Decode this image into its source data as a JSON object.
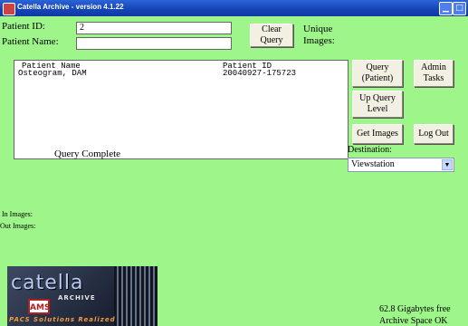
{
  "window": {
    "title": "Catella Archive - version 4.1.22"
  },
  "patient": {
    "id_label": "Patient ID:",
    "id_value": "2",
    "name_label": "Patient Name:",
    "name_value": ""
  },
  "buttons": {
    "clear_query": "Clear Query",
    "query_patient": "Query (Patient)",
    "admin_tasks": "Admin Tasks",
    "up_query_level": "Up Query Level",
    "get_images": "Get Images",
    "log_out": "Log Out"
  },
  "unique_images_label": "Unique Images:",
  "results": {
    "headers": {
      "name": "Patient Name",
      "id": "Patient ID"
    },
    "rows": [
      {
        "name": "Osteogram, DAM",
        "id": "20040927-175723"
      }
    ]
  },
  "status": {
    "query": "Query Complete"
  },
  "destination": {
    "label": "Destination:",
    "selected": "Viewstation"
  },
  "counters": {
    "in_label": "In Images:",
    "out_label": "Out Images:"
  },
  "logo": {
    "word": "catella",
    "sub": "ARCHIVE",
    "badge": "AMS",
    "tagline": "PACS Solutions Realized"
  },
  "disk": {
    "free": "62.8 Gigabytes free",
    "status": "Archive Space OK"
  },
  "icons": {
    "minimize": "minimize-icon",
    "maximize": "maximize-icon",
    "dropdown": "chevron-down-icon"
  }
}
